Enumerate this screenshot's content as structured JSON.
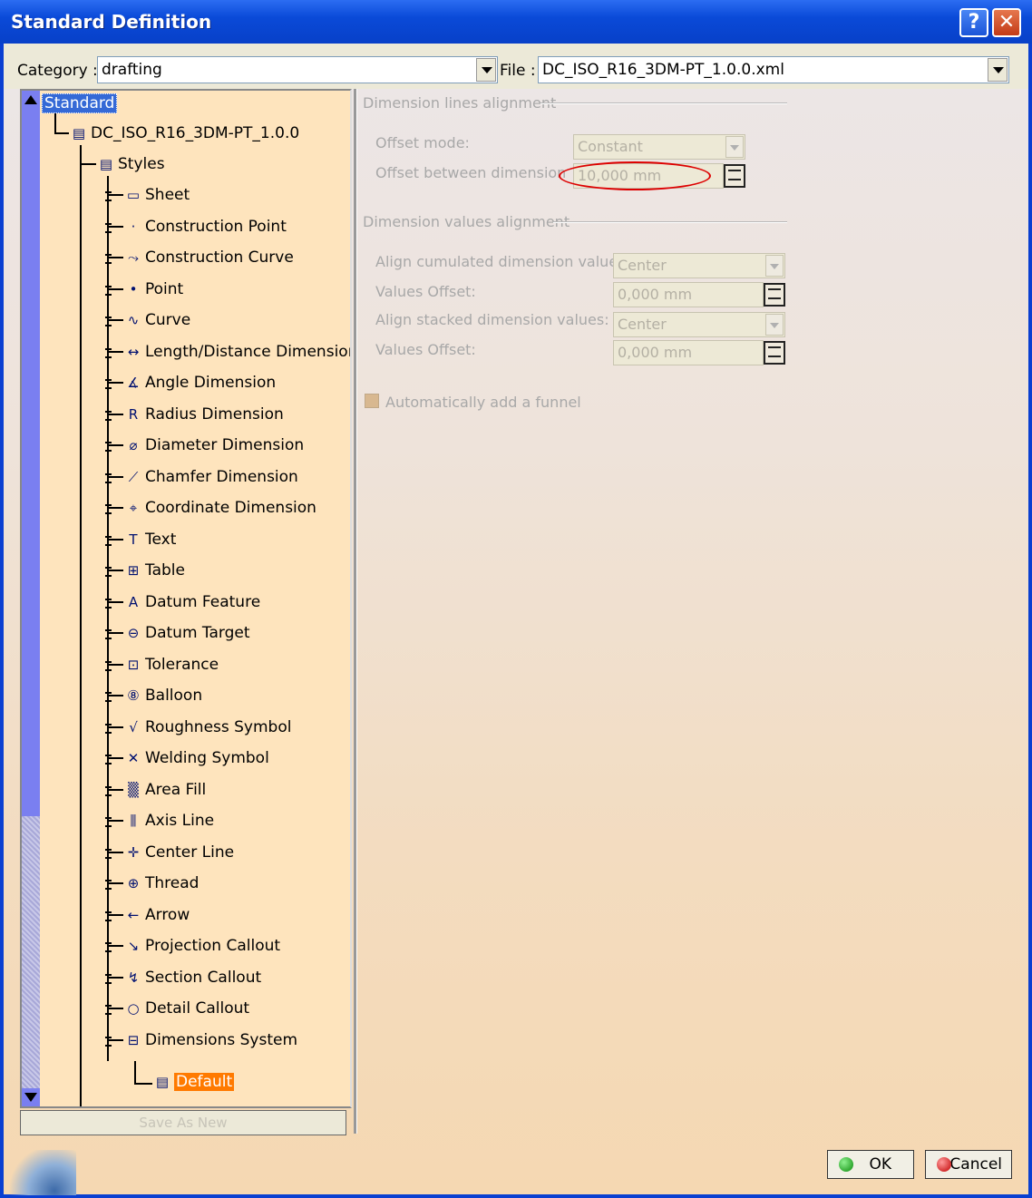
{
  "window": {
    "title": "Standard Definition",
    "help_symbol": "?",
    "close_symbol": "✕"
  },
  "category": {
    "label": "Category :",
    "value": "drafting"
  },
  "file": {
    "label": "File :",
    "value": "DC_ISO_R16_3DM-PT_1.0.0.xml"
  },
  "tree": {
    "root": "Standard",
    "standard_file": "DC_ISO_R16_3DM-PT_1.0.0",
    "styles": "Styles",
    "items": [
      {
        "label": "Sheet",
        "icon": "sheet-icon",
        "glyph": "▭"
      },
      {
        "label": "Construction Point",
        "icon": "construction-point-icon",
        "glyph": "·"
      },
      {
        "label": "Construction Curve",
        "icon": "construction-curve-icon",
        "glyph": "⤳"
      },
      {
        "label": "Point",
        "icon": "point-icon",
        "glyph": "•"
      },
      {
        "label": "Curve",
        "icon": "curve-icon",
        "glyph": "∿"
      },
      {
        "label": "Length/Distance Dimension",
        "icon": "length-dimension-icon",
        "glyph": "↔"
      },
      {
        "label": "Angle Dimension",
        "icon": "angle-dimension-icon",
        "glyph": "∡"
      },
      {
        "label": "Radius Dimension",
        "icon": "radius-dimension-icon",
        "glyph": "R"
      },
      {
        "label": "Diameter Dimension",
        "icon": "diameter-dimension-icon",
        "glyph": "⌀"
      },
      {
        "label": "Chamfer Dimension",
        "icon": "chamfer-dimension-icon",
        "glyph": "⟋"
      },
      {
        "label": "Coordinate Dimension",
        "icon": "coordinate-dimension-icon",
        "glyph": "⌖"
      },
      {
        "label": "Text",
        "icon": "text-icon",
        "glyph": "T"
      },
      {
        "label": "Table",
        "icon": "table-icon",
        "glyph": "⊞"
      },
      {
        "label": "Datum Feature",
        "icon": "datum-feature-icon",
        "glyph": "A"
      },
      {
        "label": "Datum Target",
        "icon": "datum-target-icon",
        "glyph": "⊖"
      },
      {
        "label": "Tolerance",
        "icon": "tolerance-icon",
        "glyph": "⊡"
      },
      {
        "label": "Balloon",
        "icon": "balloon-icon",
        "glyph": "⑧"
      },
      {
        "label": "Roughness Symbol",
        "icon": "roughness-symbol-icon",
        "glyph": "√"
      },
      {
        "label": "Welding Symbol",
        "icon": "welding-symbol-icon",
        "glyph": "✕"
      },
      {
        "label": "Area Fill",
        "icon": "area-fill-icon",
        "glyph": "▒"
      },
      {
        "label": "Axis Line",
        "icon": "axis-line-icon",
        "glyph": "⫼"
      },
      {
        "label": "Center Line",
        "icon": "center-line-icon",
        "glyph": "✛"
      },
      {
        "label": "Thread",
        "icon": "thread-icon",
        "glyph": "⊕"
      },
      {
        "label": "Arrow",
        "icon": "arrow-icon",
        "glyph": "←"
      },
      {
        "label": "Projection Callout",
        "icon": "projection-callout-icon",
        "glyph": "↘"
      },
      {
        "label": "Section Callout",
        "icon": "section-callout-icon",
        "glyph": "↯"
      },
      {
        "label": "Detail Callout",
        "icon": "detail-callout-icon",
        "glyph": "○"
      },
      {
        "label": "Dimensions System",
        "icon": "dimensions-system-icon",
        "glyph": "⊟"
      }
    ],
    "default_child": "Default"
  },
  "save_as_new": "Save As New",
  "dimension_lines": {
    "header": "Dimension lines alignment",
    "offset_mode_label": "Offset mode:",
    "offset_mode_value": "Constant",
    "offset_between_label": "Offset between dimension",
    "offset_between_value": "10,000 mm"
  },
  "dimension_values": {
    "header": "Dimension values alignment",
    "align_cumulated_label": "Align cumulated dimension values:",
    "align_cumulated_value": "Center",
    "values_offset_label_1": "Values Offset:",
    "values_offset_value_1": "0,000 mm",
    "align_stacked_label": "Align stacked dimension values:",
    "align_stacked_value": "Center",
    "values_offset_label_2": "Values Offset:",
    "values_offset_value_2": "0,000 mm"
  },
  "funnel_checkbox": "Automatically add a funnel",
  "buttons": {
    "ok": "OK",
    "cancel": "Cancel"
  },
  "colors": {
    "title_bar": "#0a4ad8",
    "selection": "#3569d6",
    "default_highlight": "#ff7a00",
    "tree_bg": "#fee4bd",
    "annotation": "#dd0000"
  }
}
